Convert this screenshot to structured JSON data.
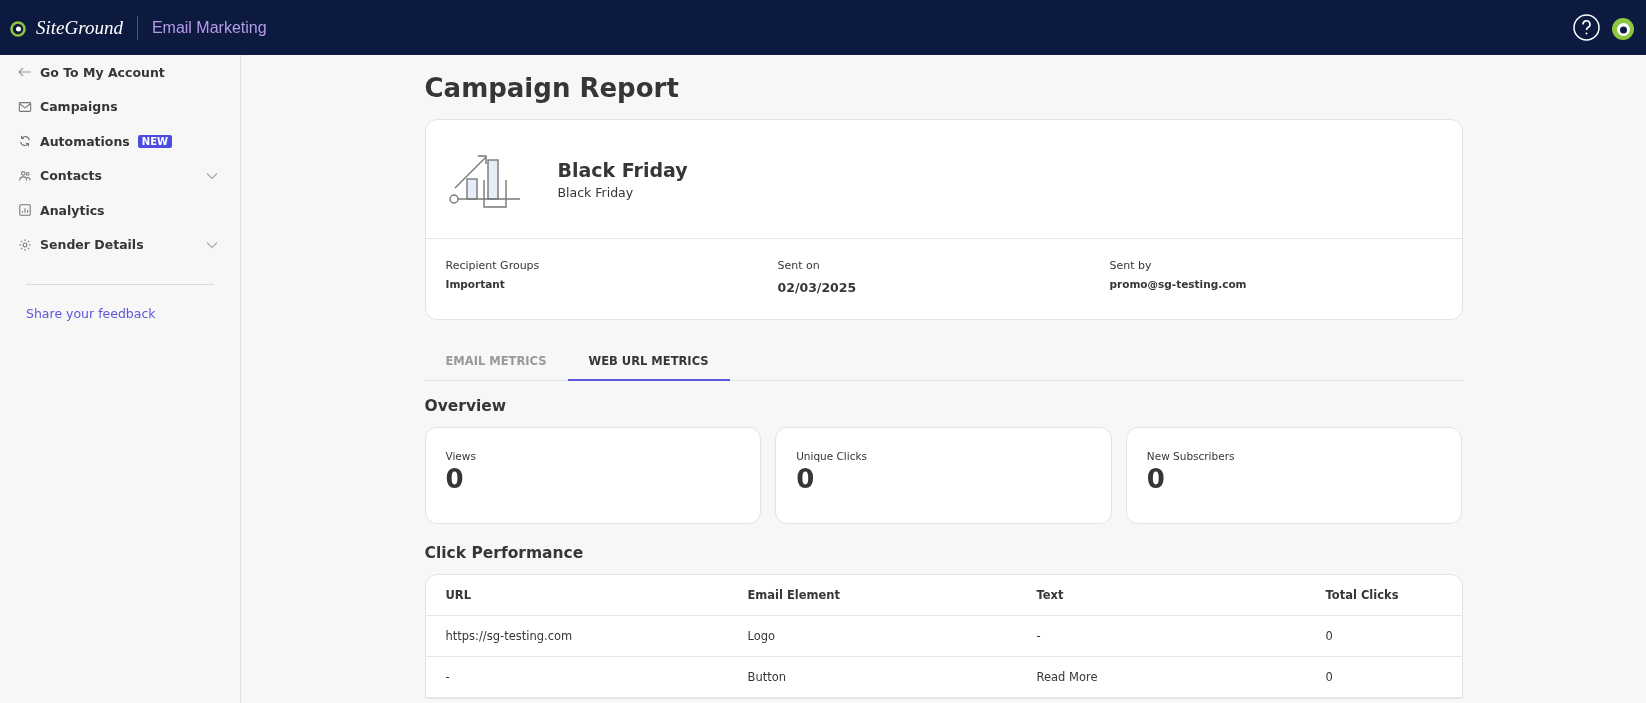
{
  "header": {
    "brand": "SiteGround",
    "product": "Email Marketing"
  },
  "sidebar": {
    "back": "Go To My Account",
    "items": [
      {
        "kind": "mail",
        "label": "Campaigns",
        "expandable": false
      },
      {
        "kind": "cycle",
        "label": "Automations",
        "badge": "NEW",
        "expandable": false
      },
      {
        "kind": "people",
        "label": "Contacts",
        "expandable": true
      },
      {
        "kind": "chart",
        "label": "Analytics",
        "expandable": false
      },
      {
        "kind": "gear",
        "label": "Sender Details",
        "expandable": true
      }
    ],
    "feedback": "Share your feedback"
  },
  "page": {
    "title": "Campaign Report"
  },
  "campaign": {
    "name": "Black Friday",
    "subject": "Black Friday",
    "details": [
      {
        "label": "Recipient Groups",
        "value": "Important"
      },
      {
        "label": "Sent on",
        "value": "02/03/2025"
      },
      {
        "label": "Sent by",
        "value": "promo@sg-testing.com"
      }
    ]
  },
  "tabs": [
    {
      "label": "EMAIL METRICS",
      "selected": false
    },
    {
      "label": "WEB URL METRICS",
      "selected": true
    }
  ],
  "overview": {
    "title": "Overview",
    "metrics": [
      {
        "label": "Views",
        "value": "0"
      },
      {
        "label": "Unique Clicks",
        "value": "0"
      },
      {
        "label": "New Subscribers",
        "value": "0"
      }
    ]
  },
  "click_performance": {
    "title": "Click Performance",
    "columns": [
      "URL",
      "Email Element",
      "Text",
      "Total Clicks"
    ],
    "rows": [
      [
        "https://sg-testing.com",
        "Logo",
        "-",
        "0"
      ],
      [
        "-",
        "Button",
        "Read More",
        "0"
      ]
    ]
  }
}
